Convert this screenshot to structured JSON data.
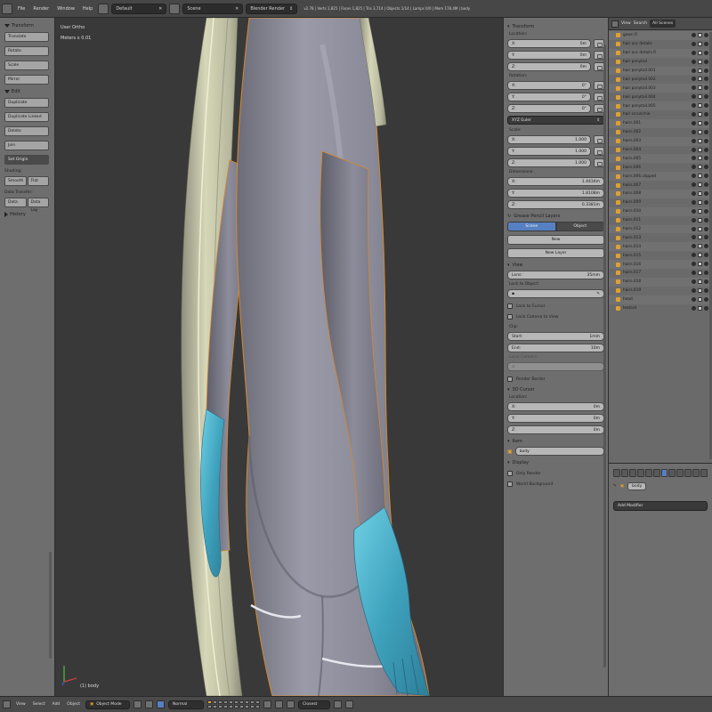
{
  "topbar": {
    "menus": [
      "File",
      "Render",
      "Window",
      "Help"
    ],
    "layout": "Default",
    "scene": "Scene",
    "engine": "Blender Render",
    "status": "v2.78 | Verts 1,825 | Faces 1,825 | Tris 3,714 | Objects 1/14 | Lamps 0/0 | Mem 178.4M | body"
  },
  "viewport": {
    "view_label": "User Ortho",
    "scale_label": "Meters x 0.01",
    "object_label": "(1) body"
  },
  "toolshelf": {
    "transform_header": "Transform",
    "transform_buttons": [
      "Translate",
      "Rotate",
      "Scale",
      "Mirror"
    ],
    "edit_header": "Edit",
    "edit_buttons": [
      "Duplicate",
      "Duplicate Linked",
      "Delete",
      "Join"
    ],
    "set_origin": "Set Origin",
    "shading_label": "Shading:",
    "shading_buttons": [
      "Smooth",
      "Flat"
    ],
    "data_transfer_label": "Data Transfer:",
    "data_transfer_buttons": [
      "Data",
      "Data Lay"
    ],
    "history_header": "History"
  },
  "properties": {
    "transform_header": "Transform",
    "location_label": "Location:",
    "location": [
      {
        "axis": "X:",
        "value": "0m"
      },
      {
        "axis": "Y:",
        "value": "0m"
      },
      {
        "axis": "Z:",
        "value": "0m"
      }
    ],
    "rotation_label": "Rotation:",
    "rotation": [
      {
        "axis": "X:",
        "value": "0°"
      },
      {
        "axis": "Y:",
        "value": "0°"
      },
      {
        "axis": "Z:",
        "value": "0°"
      }
    ],
    "rotation_mode": "XYZ Euler",
    "scale_label": "Scale:",
    "scale": [
      {
        "axis": "X:",
        "value": "1.000"
      },
      {
        "axis": "Y:",
        "value": "1.000"
      },
      {
        "axis": "Z:",
        "value": "1.000"
      }
    ],
    "dimensions_label": "Dimensions:",
    "dimensions": [
      {
        "axis": "X:",
        "value": "1.4434m"
      },
      {
        "axis": "Y:",
        "value": "1.8108m"
      },
      {
        "axis": "Z:",
        "value": "0.3381m"
      }
    ],
    "gp_header": "Grease Pencil Layers",
    "gp_tabs": [
      "Scene",
      "Object"
    ],
    "gp_new": "New",
    "gp_new_layer": "New Layer",
    "view_header": "View",
    "lens_label": "Lens:",
    "lens_value": "35mm",
    "lock_to_object_label": "Lock to Object:",
    "lock_to_cursor": "Lock to Cursor",
    "lock_camera": "Lock Camera to View",
    "clip_label": "Clip:",
    "clip_start_label": "Start:",
    "clip_start_value": "1mm",
    "clip_end_label": "End:",
    "clip_end_value": "10m",
    "local_camera_label": "Local Camera:",
    "render_border": "Render Border",
    "cursor_header": "3D Cursor",
    "cursor_location_label": "Location:",
    "cursor_location": [
      {
        "axis": "X:",
        "value": "0m"
      },
      {
        "axis": "Y:",
        "value": "0m"
      },
      {
        "axis": "Z:",
        "value": "0m"
      }
    ],
    "item_header": "Item",
    "item_name": "body",
    "display_header": "Display",
    "only_render": "Only Render",
    "world_background": "World Background"
  },
  "outliner": {
    "menus": [
      "View",
      "Search"
    ],
    "filter": "All Scenes",
    "items": [
      "gown R",
      "hair acc details",
      "hair acc details R",
      "hair ponytail",
      "hair ponytail.001",
      "hair ponytail.002",
      "hair ponytail.003",
      "hair ponytail.004",
      "hair ponytail.005",
      "hair scrunchie",
      "hairs.001",
      "hairs.002",
      "hairs.003",
      "hairs.004",
      "hairs.005",
      "hairs.006",
      "hairs.006.clipped",
      "hairs.007",
      "hairs.008",
      "hairs.009",
      "hairs.010",
      "hairs.011",
      "hairs.012",
      "hairs.013",
      "hairs.014",
      "hairs.015",
      "hairs.016",
      "hairs.017",
      "hairs.018",
      "hairs.019",
      "head",
      "leotard"
    ]
  },
  "modifiers": {
    "object_name": "body",
    "add_modifier": "Add Modifier"
  },
  "bottombar": {
    "menus": [
      "View",
      "Select",
      "Add",
      "Object"
    ],
    "mode": "Object Mode",
    "pivot": "Normal",
    "snap": "Closest"
  },
  "colors": {
    "viewport_bg": "#393939",
    "panel_bg": "#6e6e6e",
    "accent_blue": "#5680c2",
    "glove_cyan": "#4fb0c8",
    "hair_cream": "#cfcfae",
    "body_gray": "#8e8e9c",
    "selection_orange": "#e8a636"
  }
}
